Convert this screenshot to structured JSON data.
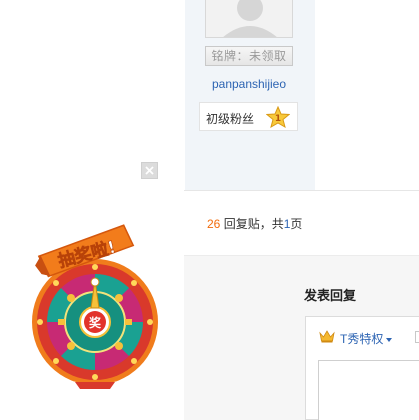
{
  "user": {
    "badge_button": "铭牌：未领取",
    "username": "panpanshijieo",
    "fan_level": "初级粉丝",
    "fan_star_num": "1"
  },
  "replies": {
    "count": "26",
    "mid_text": " 回复贴，共",
    "pages": "1",
    "suffix": "页"
  },
  "reply_form": {
    "title": "发表回复",
    "tshow_label": "T秀特权"
  },
  "lottery": {
    "banner": "抽奖啦!",
    "center": "奖"
  },
  "colors": {
    "link": "#2d64b3",
    "accent_orange": "#f26c0d",
    "wheel_red": "#d9392b",
    "wheel_teal": "#1aa192",
    "wheel_gold": "#f6c13a"
  }
}
